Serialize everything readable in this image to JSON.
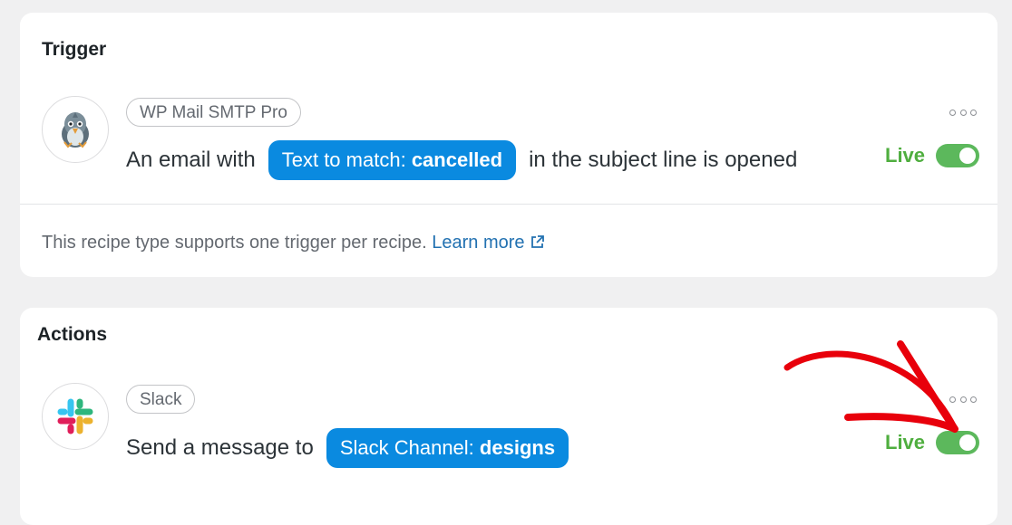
{
  "trigger": {
    "title": "Trigger",
    "integration": "WP Mail SMTP Pro",
    "logo_icon": "pigeon-icon",
    "sentence_before": "An email with",
    "token_label": "Text to match:",
    "token_value": "cancelled",
    "sentence_after": "in the subject line is opened",
    "status_label": "Live",
    "status_on": true,
    "footer_text": "This recipe type supports one trigger per recipe.",
    "learn_more": "Learn more"
  },
  "actions": {
    "title": "Actions",
    "integration": "Slack",
    "logo_icon": "slack-icon",
    "sentence_before": "Send a message to",
    "token_label": "Slack Channel:",
    "token_value": "designs",
    "status_label": "Live",
    "status_on": true
  },
  "colors": {
    "token": "#0a8ae0",
    "live": "#4fae3f",
    "toggle": "#5cb85c",
    "annotation": "#e8000b"
  }
}
